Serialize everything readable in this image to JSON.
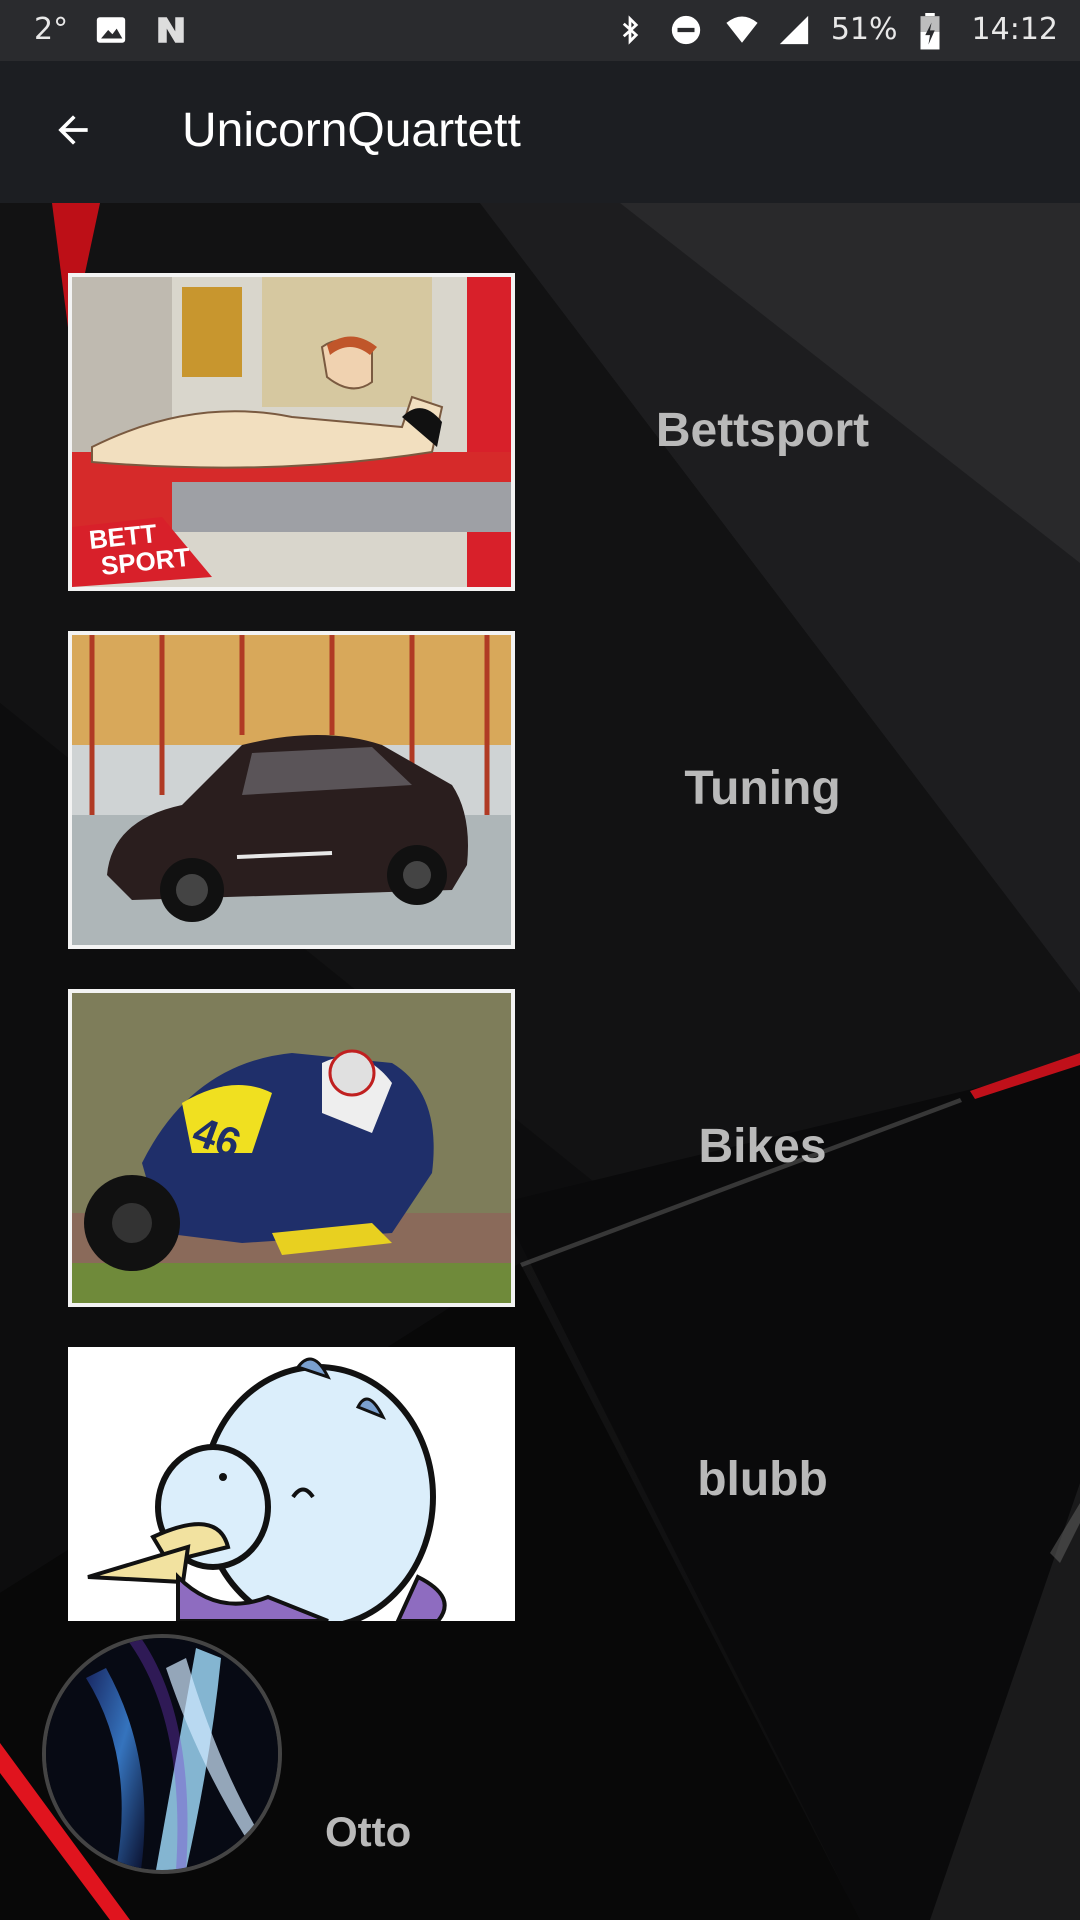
{
  "status_bar": {
    "temperature": "2°",
    "battery": "51%",
    "time": "14:12",
    "icons": [
      "image-icon",
      "n-icon",
      "bluetooth-icon",
      "dnd-icon",
      "wifi-icon",
      "signal-icon",
      "battery-icon"
    ]
  },
  "toolbar": {
    "title": "UnicornQuartett",
    "back_icon": "arrow-back-icon"
  },
  "categories": [
    {
      "label": "Bettsport",
      "image": "bettsport-image"
    },
    {
      "label": "Tuning",
      "image": "car-image"
    },
    {
      "label": "Bikes",
      "image": "motorbike-image"
    },
    {
      "label": "blubb",
      "image": "unicorn-image"
    }
  ],
  "profile": {
    "name": "Otto"
  },
  "colors": {
    "toolbar_bg": "#1c1e22",
    "status_bg": "#2a2b2e",
    "label_text": "#b9b9b9",
    "accent_red": "#e0141e"
  }
}
